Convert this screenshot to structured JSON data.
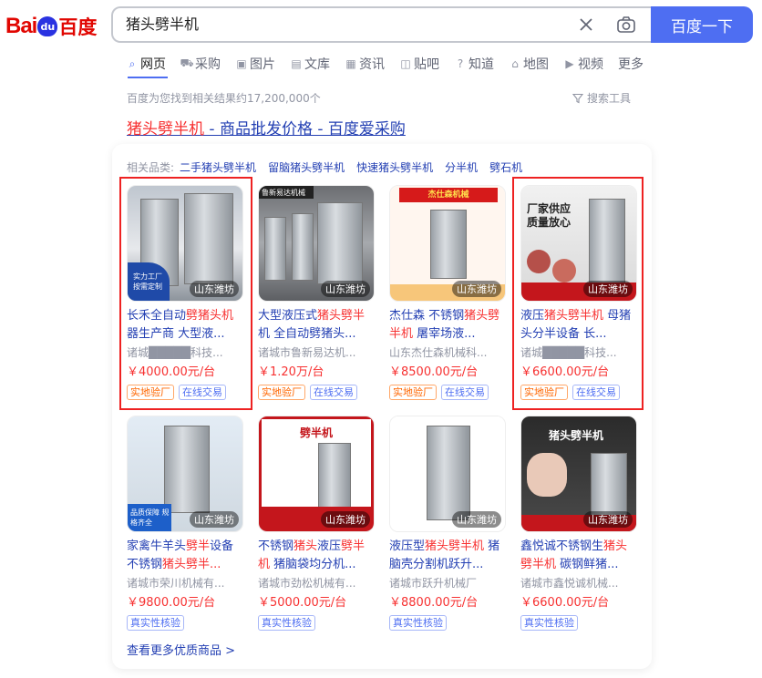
{
  "header": {
    "logo_bai": "Bai",
    "logo_du": "du",
    "logo_cn": "百度",
    "search_value": "猪头劈半机",
    "search_button": "百度一下"
  },
  "tabs": [
    {
      "label": "网页",
      "icon": "search-icon"
    },
    {
      "label": "采购",
      "icon": "cart-icon"
    },
    {
      "label": "图片",
      "icon": "picture-icon"
    },
    {
      "label": "文库",
      "icon": "document-icon"
    },
    {
      "label": "资讯",
      "icon": "news-icon"
    },
    {
      "label": "贴吧",
      "icon": "forum-icon"
    },
    {
      "label": "知道",
      "icon": "question-icon"
    },
    {
      "label": "地图",
      "icon": "map-icon"
    },
    {
      "label": "视频",
      "icon": "video-icon"
    },
    {
      "label": "更多",
      "icon": ""
    }
  ],
  "results": {
    "count_text": "百度为您找到相关结果约17,200,000个",
    "tools_label": "搜索工具",
    "title_highlight": "猪头劈半机",
    "title_rest": " - 商品批发价格 - 百度爱采购"
  },
  "related": {
    "label": "相关品类:",
    "items": [
      "二手猪头劈半机",
      "留脑猪头劈半机",
      "快速猪头劈半机",
      "分半机",
      "劈石机"
    ]
  },
  "products": [
    {
      "title_parts": [
        "长禾全自动",
        "劈猪头机",
        "器生产商 大型液..."
      ],
      "company": "诸城█████科技...",
      "price": "￥4000.00元/台",
      "location": "山东潍坊",
      "tags": [
        {
          "t": "实地验厂",
          "c": "orange"
        },
        {
          "t": "在线交易",
          "c": "blue"
        }
      ],
      "img_text": "实力工厂 按需定制"
    },
    {
      "title_parts": [
        "大型液压式",
        "猪头劈半",
        "机 全自动劈猪头..."
      ],
      "company": "诸城市鲁新易达机...",
      "price": "￥1.20万/台",
      "location": "山东潍坊",
      "tags": [
        {
          "t": "实地验厂",
          "c": "orange"
        },
        {
          "t": "在线交易",
          "c": "blue"
        }
      ],
      "img_text": "鲁新易达机械"
    },
    {
      "title_parts": [
        "杰仕森 不锈钢",
        "猪头劈半机",
        " 屠宰场液..."
      ],
      "company": "山东杰仕森机械科...",
      "price": "￥8500.00元/台",
      "location": "山东潍坊",
      "tags": [
        {
          "t": "实地验厂",
          "c": "orange"
        },
        {
          "t": "在线交易",
          "c": "blue"
        }
      ],
      "img_text": "杰仕森机械"
    },
    {
      "title_parts": [
        "液压",
        "猪头劈半机",
        " 母猪头分半设备 长..."
      ],
      "company": "诸城█████科技...",
      "price": "￥6600.00元/台",
      "location": "山东潍坊",
      "tags": [
        {
          "t": "实地验厂",
          "c": "orange"
        },
        {
          "t": "在线交易",
          "c": "blue"
        }
      ],
      "img_text": "厂家供应 质量放心"
    },
    {
      "title_parts": [
        "家禽牛羊头",
        "劈半",
        "设备 不锈钢",
        "猪头劈半..."
      ],
      "company": "诸城市荣川机械有...",
      "price": "￥9800.00元/台",
      "location": "山东潍坊",
      "tags": [
        {
          "t": "真实性核验",
          "c": "blue"
        }
      ],
      "img_text": "品质保障 规格齐全"
    },
    {
      "title_parts": [
        "不锈钢",
        "猪头",
        "液压",
        "劈半机",
        " 猪脑袋均分机..."
      ],
      "company": "诸城市劲松机械有...",
      "price": "￥5000.00元/台",
      "location": "山东潍坊",
      "tags": [
        {
          "t": "真实性核验",
          "c": "blue"
        }
      ],
      "img_text": "劈半机"
    },
    {
      "title_parts": [
        "液压型",
        "猪头劈半机",
        " 猪脑壳分割机跃升..."
      ],
      "company": "诸城市跃升机械厂",
      "price": "￥8800.00元/台",
      "location": "山东潍坊",
      "tags": [
        {
          "t": "真实性核验",
          "c": "blue"
        }
      ],
      "img_text": ""
    },
    {
      "title_parts": [
        "鑫悦诚不锈钢生",
        "猪头",
        "劈半机",
        " 碳钢鲜猪..."
      ],
      "company": "诸城市鑫悦诚机械...",
      "price": "￥6600.00元/台",
      "location": "山东潍坊",
      "tags": [
        {
          "t": "真实性核验",
          "c": "blue"
        }
      ],
      "img_text": "猪头劈半机"
    }
  ],
  "more_link": "查看更多优质商品 >"
}
